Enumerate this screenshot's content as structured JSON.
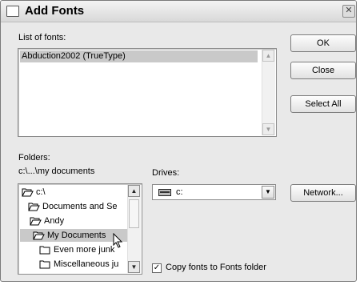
{
  "window": {
    "title": "Add Fonts",
    "close_glyph": "✕"
  },
  "fonts": {
    "label": "List of fonts:",
    "items": [
      "Abduction2002 (TrueType)"
    ]
  },
  "buttons": {
    "ok": "OK",
    "close": "Close",
    "select_all": "Select All",
    "network": "Network..."
  },
  "folders": {
    "label": "Folders:",
    "path": "c:\\...\\my documents",
    "items": [
      {
        "label": "c:\\",
        "icon": "open-folder-icon"
      },
      {
        "label": "Documents and Se",
        "icon": "open-folder-icon"
      },
      {
        "label": "Andy",
        "icon": "open-folder-icon"
      },
      {
        "label": "My Documents",
        "icon": "open-folder-icon",
        "selected": true
      },
      {
        "label": "Even more junk",
        "icon": "closed-folder-icon"
      },
      {
        "label": "Miscellaneous ju",
        "icon": "closed-folder-icon"
      }
    ]
  },
  "drives": {
    "label": "Drives:",
    "value": "c:",
    "icon": "drive-icon"
  },
  "copy_option": {
    "label": "Copy fonts to Fonts folder",
    "checked": true,
    "check_glyph": "✓"
  },
  "scroll_glyphs": {
    "up": "▲",
    "down": "▼"
  }
}
